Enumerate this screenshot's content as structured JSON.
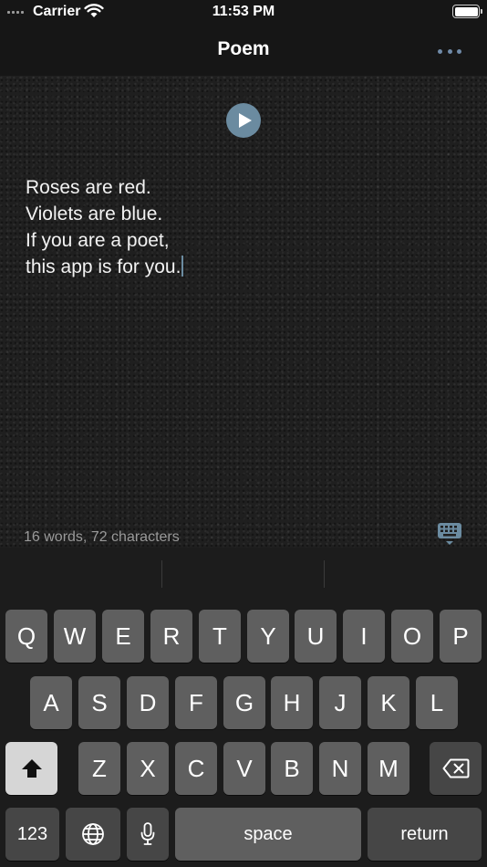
{
  "status_bar": {
    "carrier": "Carrier",
    "time": "11:53 PM"
  },
  "nav": {
    "title": "Poem",
    "more_icon": "ellipsis-icon"
  },
  "editor": {
    "play_icon": "play-icon",
    "poem_lines": [
      "Roses are red.",
      "Violets are blue.",
      "If you are a poet,",
      "this app is for you."
    ],
    "counter": "16 words, 72 characters",
    "keyboard_toggle_icon": "keyboard-dismiss-icon"
  },
  "keyboard": {
    "row1": [
      "Q",
      "W",
      "E",
      "R",
      "T",
      "Y",
      "U",
      "I",
      "O",
      "P"
    ],
    "row2": [
      "A",
      "S",
      "D",
      "F",
      "G",
      "H",
      "J",
      "K",
      "L"
    ],
    "row3": [
      "Z",
      "X",
      "C",
      "V",
      "B",
      "N",
      "M"
    ],
    "numbers_label": "123",
    "space_label": "space",
    "return_label": "return",
    "shift_icon": "shift-icon",
    "delete_icon": "delete-icon",
    "globe_icon": "globe-icon",
    "mic_icon": "microphone-icon"
  },
  "colors": {
    "accent": "#6b8ba0",
    "key": "#5f5f5f",
    "key_dark": "#464646",
    "background": "#1f1f1f"
  }
}
